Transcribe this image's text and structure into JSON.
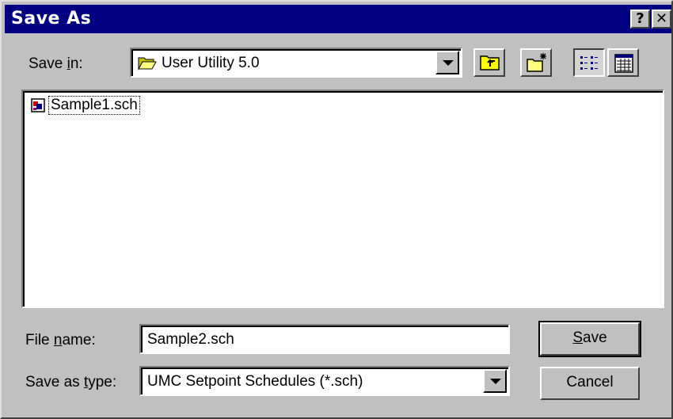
{
  "window": {
    "title": "Save As",
    "help_label": "?",
    "close_label": "✕"
  },
  "save_in": {
    "label_prefix": "Save ",
    "label_underlined": "i",
    "label_suffix": "n:",
    "value": "User Utility 5.0",
    "icon": "folder-open-icon"
  },
  "toolbar": {
    "up_folder": "up-one-level-icon",
    "new_folder": "new-folder-icon",
    "list_view": "list-view-icon",
    "details_view": "details-view-icon"
  },
  "files": [
    {
      "name": "Sample1.sch",
      "icon": "schedule-file-icon"
    }
  ],
  "file_name": {
    "label_prefix": "File ",
    "label_underlined": "n",
    "label_suffix": "ame:",
    "value": "Sample2.sch"
  },
  "save_type": {
    "label_prefix": "Save as ",
    "label_underlined": "t",
    "label_suffix": "ype:",
    "value": "UMC Setpoint Schedules (*.sch)"
  },
  "buttons": {
    "save_underlined": "S",
    "save_rest": "ave",
    "cancel": "Cancel"
  }
}
